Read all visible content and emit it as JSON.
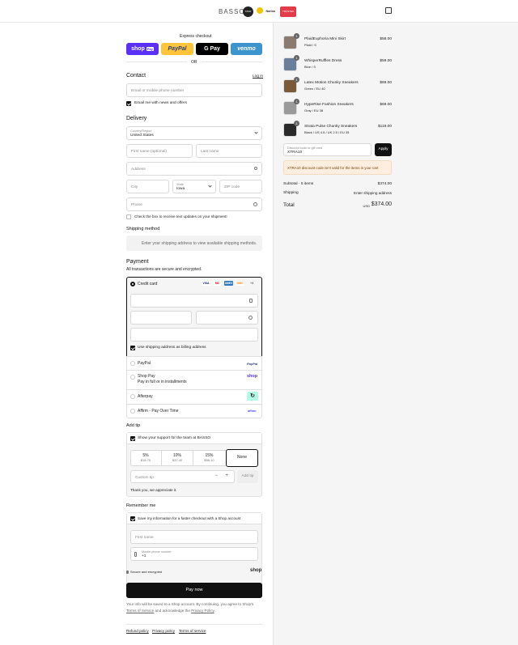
{
  "header": {
    "brand": "BASSO",
    "badge_1": "STAR",
    "badge_2": "Norton",
    "badge_3": "TRUSTED"
  },
  "express": {
    "title": "Express checkout",
    "shop_pay": "shop",
    "shop_pay_tag": "Pay",
    "paypal": "PayPal",
    "gpay": "G Pay",
    "venmo": "venmo",
    "or": "OR"
  },
  "contact": {
    "title": "Contact",
    "login": "Log in",
    "email_placeholder": "Email or mobile phone number",
    "news_label": "Email me with news and offers"
  },
  "delivery": {
    "title": "Delivery",
    "country_label": "Country/Region",
    "country_value": "United States",
    "first_name": "First name (optional)",
    "last_name": "Last name",
    "address": "Address",
    "city": "City",
    "state_label": "State",
    "state_value": "Iowa",
    "zip": "ZIP code",
    "phone": "Phone",
    "sms_label": "Check the box to receive text updates on your shipment!"
  },
  "shipping": {
    "title": "Shipping method",
    "message": "Enter your shipping address to view available shipping methods."
  },
  "payment": {
    "title": "Payment",
    "subtitle": "All transactions are secure and encrypted.",
    "credit_card": "Credit card",
    "card_logos": [
      "VISA",
      "MC",
      "AMEX",
      "DISC",
      "+4"
    ],
    "billing_label": "Use shipping address as billing address",
    "options": [
      {
        "label": "PayPal",
        "sub": "",
        "logo": "PayPal"
      },
      {
        "label": "Shop Pay",
        "sub": "Pay in full or in installments",
        "logo": "shop"
      },
      {
        "label": "Afterpay",
        "sub": "",
        "logo": "↻"
      },
      {
        "label": "Affirm - Pay Over Time",
        "sub": "",
        "logo": "affirm"
      }
    ]
  },
  "tip": {
    "title": "Add tip",
    "support_label": "Show your support for the team at BASSO",
    "options": [
      {
        "pct": "5%",
        "amt": "$18.70"
      },
      {
        "pct": "10%",
        "amt": "$37.40"
      },
      {
        "pct": "15%",
        "amt": "$56.10"
      },
      {
        "pct": "None",
        "amt": ""
      }
    ],
    "custom_placeholder": "Custom tip",
    "add_button": "Add tip",
    "thanks": "Thank you, we appreciate it."
  },
  "remember": {
    "title": "Remember me",
    "save_label": "Save my information for a faster checkout with a Shop account",
    "first_name": "First name",
    "mobile_label": "Mobile phone number",
    "mobile_value": "+1",
    "secure": "Secure and encrypted",
    "shop": "shop"
  },
  "pay_button": "Pay now",
  "legal": {
    "line1": "Your info will be saved to a Shop account. By continuing, you agree to Shop's",
    "tos": "Terms of Service",
    "and": "and acknowledge the",
    "privacy": "Privacy Policy",
    "period": "."
  },
  "footer": {
    "links": [
      "Refund policy",
      "Privacy policy",
      "Terms of service"
    ]
  },
  "cart": {
    "items": [
      {
        "name": "PlaidEuphoria Mini Skirt",
        "variant": "Plaid / S",
        "qty": "1",
        "price": "$58.00",
        "color": "#8a7a70"
      },
      {
        "name": "WhisperRuffles Dress",
        "variant": "Blue / S",
        "qty": "1",
        "price": "$59.00",
        "color": "#6a7f9a"
      },
      {
        "name": "Latex Motion Chunky Sneakers",
        "variant": "Green / EU 40",
        "qty": "1",
        "price": "$69.00",
        "color": "#7a5a3a"
      },
      {
        "name": "HypeRise Fashion Sneakers",
        "variant": "Gray / EU 38",
        "qty": "1",
        "price": "$69.00",
        "color": "#9a9a9a"
      },
      {
        "name": "Strata Pulse Chunky Sneakers",
        "variant": "Black / US 4.5 / UK 2.5 / EU 35",
        "qty": "1",
        "price": "$119.00",
        "color": "#2a2a2a"
      }
    ],
    "discount_label": "Discount code or gift card",
    "discount_value": "XTRA10",
    "apply": "Apply",
    "error": "XTRA10 discount code isn't valid for the items in your cart",
    "subtotal_label": "Subtotal · 5 items",
    "subtotal_value": "$374.00",
    "shipping_label": "Shipping",
    "shipping_value": "Enter shipping address",
    "total_label": "Total",
    "currency": "USD",
    "total_value": "$374.00"
  }
}
